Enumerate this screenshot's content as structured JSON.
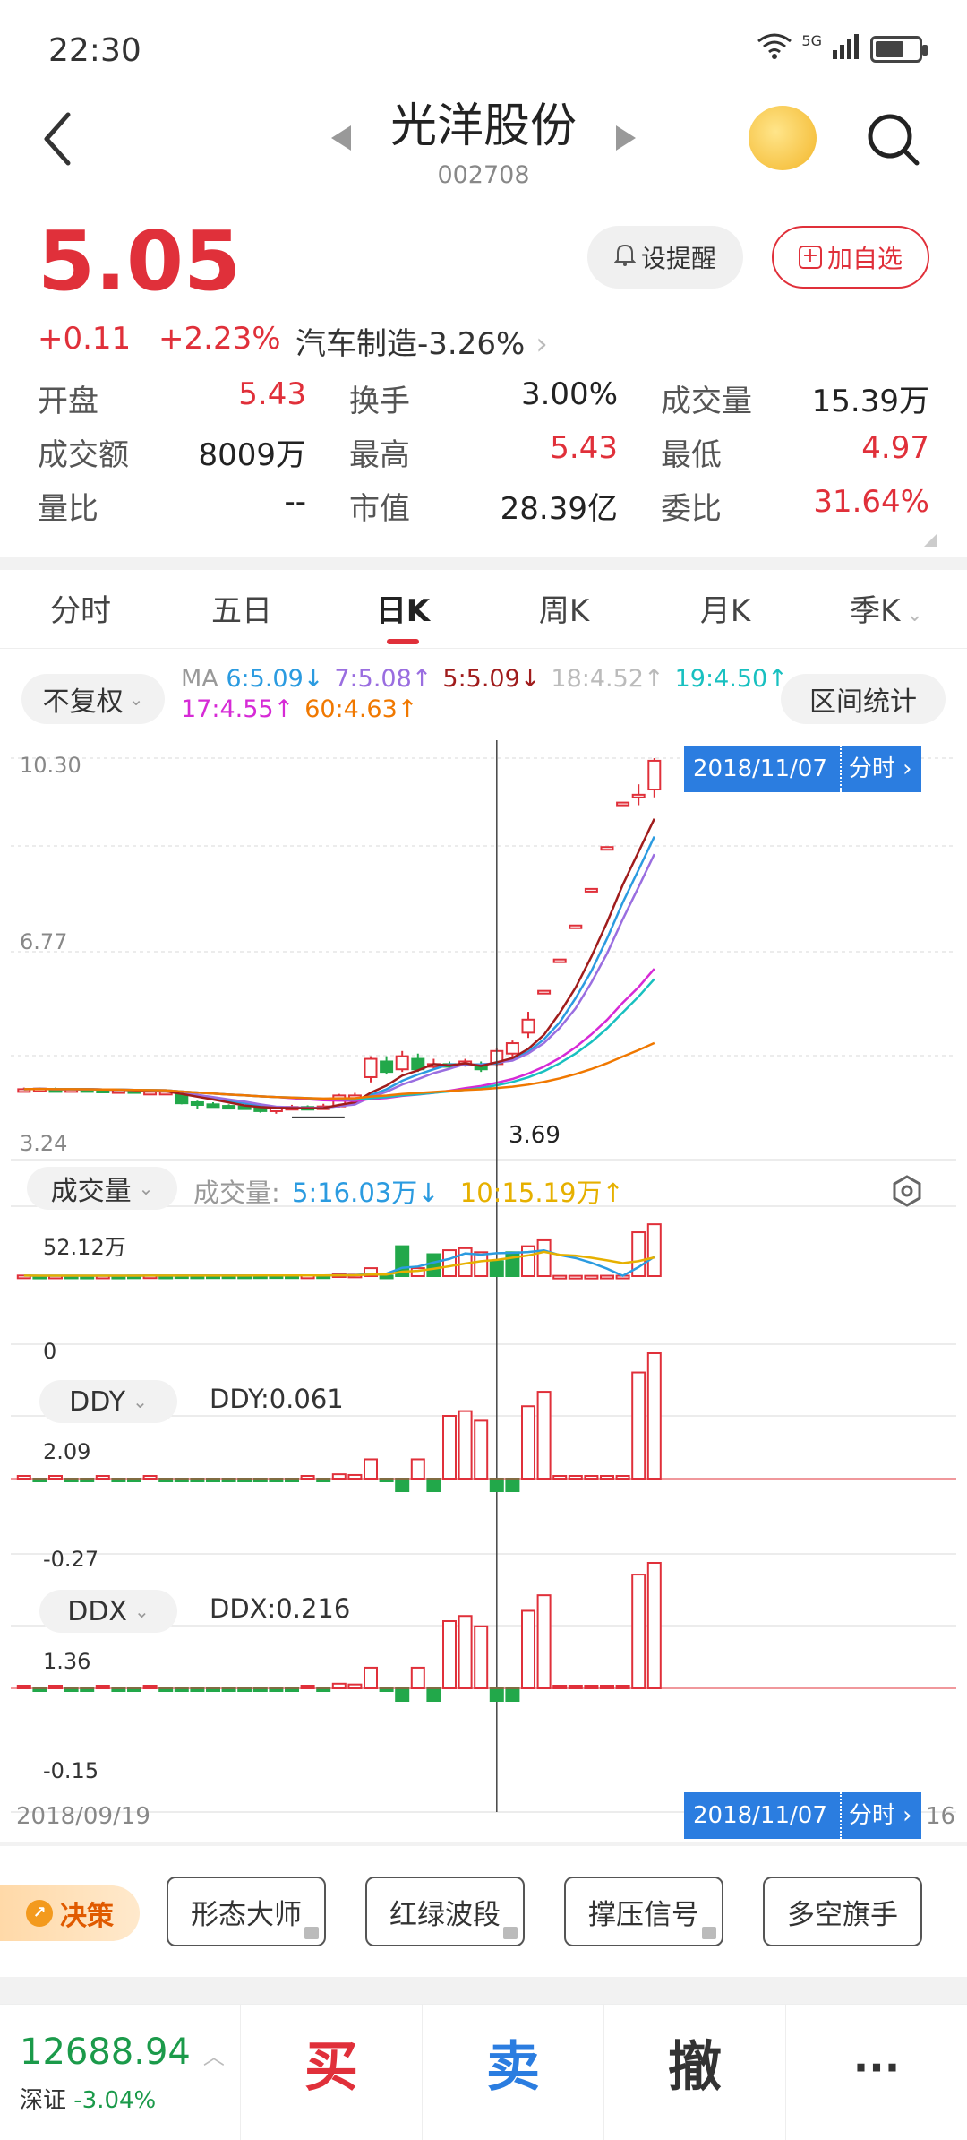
{
  "status": {
    "time": "22:30",
    "network": "5G"
  },
  "header": {
    "stock_name": "光洋股份",
    "stock_code": "002708"
  },
  "quote": {
    "price": "5.05",
    "change": "+0.11",
    "change_pct": "+2.23%",
    "sector": "汽车制造-3.26%",
    "remind_label": "设提醒",
    "fav_label": "加自选"
  },
  "stats": [
    [
      {
        "k": "开盘",
        "v": "5.43",
        "red": true
      },
      {
        "k": "换手",
        "v": "3.00%",
        "red": false
      },
      {
        "k": "成交量",
        "v": "15.39万",
        "red": false
      }
    ],
    [
      {
        "k": "成交额",
        "v": "8009万",
        "red": false
      },
      {
        "k": "最高",
        "v": "5.43",
        "red": true
      },
      {
        "k": "最低",
        "v": "4.97",
        "red": true
      }
    ],
    [
      {
        "k": "量比",
        "v": "--",
        "red": false
      },
      {
        "k": "市值",
        "v": "28.39亿",
        "red": false
      },
      {
        "k": "委比",
        "v": "31.64%",
        "red": true
      }
    ]
  ],
  "tabs": [
    "分时",
    "五日",
    "日K",
    "周K",
    "月K",
    "季K"
  ],
  "active_tab": "日K",
  "ma": {
    "fq_label": "不复权",
    "range_label": "区间统计",
    "prefix": "MA",
    "items1": [
      {
        "text": "6:5.09↓",
        "color": "#2b9be0"
      },
      {
        "text": "7:5.08↑",
        "color": "#9a6ee0"
      },
      {
        "text": "5:5.09↓",
        "color": "#a01c1c"
      },
      {
        "text": "18:4.52↑",
        "color": "#bbbbbb"
      },
      {
        "text": "19:4.50↑",
        "color": "#18c0c0"
      }
    ],
    "items2": [
      {
        "text": "17:4.55↑",
        "color": "#d62ad6"
      },
      {
        "text": "60:4.63↑",
        "color": "#f07800"
      }
    ]
  },
  "kline": {
    "y_top": "10.30",
    "y_mid": "6.77",
    "y_bottom": "3.24",
    "low_marker": "3.69",
    "cursor_date": "2018/11/07",
    "cursor_link": "分时",
    "start_date": "2018/09/19",
    "end_label": "16"
  },
  "volume": {
    "button": "成交量",
    "label": "成交量:",
    "ma5": "5:16.03万↓",
    "ma10": "10:15.19万↑",
    "y_top": "52.12万",
    "y_zero": "0"
  },
  "ddy": {
    "button": "DDY",
    "value_label": "DDY:0.061",
    "y_top": "2.09",
    "y_bottom": "-0.27"
  },
  "ddx": {
    "button": "DDX",
    "value_label": "DDX:0.216",
    "y_top": "1.36",
    "y_bottom": "-0.15"
  },
  "strategy": {
    "decision": "决策",
    "buttons": [
      "形态大师",
      "红绿波段",
      "撑压信号",
      "多空旗手"
    ]
  },
  "trade": {
    "index_value": "12688.94",
    "index_name": "深证",
    "index_change": "-3.04%",
    "buy": "买",
    "sell": "卖",
    "cancel": "撤",
    "more": "···"
  },
  "chart_data": [
    {
      "type": "candlestick",
      "ylim": [
        3.24,
        10.3
      ],
      "candles": [
        {
          "o": 3.95,
          "c": 3.97,
          "h": 4.0,
          "l": 3.92
        },
        {
          "o": 3.96,
          "c": 3.98,
          "h": 4.0,
          "l": 3.93
        },
        {
          "o": 3.97,
          "c": 3.96,
          "h": 4.0,
          "l": 3.93
        },
        {
          "o": 3.96,
          "c": 3.97,
          "h": 3.99,
          "l": 3.93
        },
        {
          "o": 3.97,
          "c": 3.96,
          "h": 3.99,
          "l": 3.93
        },
        {
          "o": 3.96,
          "c": 3.95,
          "h": 3.98,
          "l": 3.92
        },
        {
          "o": 3.95,
          "c": 3.95,
          "h": 3.98,
          "l": 3.92
        },
        {
          "o": 3.95,
          "c": 3.91,
          "h": 3.97,
          "l": 3.9
        },
        {
          "o": 3.91,
          "c": 3.92,
          "h": 3.95,
          "l": 3.89
        },
        {
          "o": 3.92,
          "c": 3.92,
          "h": 3.95,
          "l": 3.89
        },
        {
          "o": 3.92,
          "c": 3.7,
          "h": 3.93,
          "l": 3.68
        },
        {
          "o": 3.72,
          "c": 3.68,
          "h": 3.75,
          "l": 3.6
        },
        {
          "o": 3.68,
          "c": 3.65,
          "h": 3.72,
          "l": 3.62
        },
        {
          "o": 3.65,
          "c": 3.63,
          "h": 3.68,
          "l": 3.6
        },
        {
          "o": 3.64,
          "c": 3.63,
          "h": 3.67,
          "l": 3.6
        },
        {
          "o": 3.63,
          "c": 3.55,
          "h": 3.66,
          "l": 3.52
        },
        {
          "o": 3.55,
          "c": 3.6,
          "h": 3.64,
          "l": 3.5
        },
        {
          "o": 3.6,
          "c": 3.63,
          "h": 3.67,
          "l": 3.58
        },
        {
          "o": 3.63,
          "c": 3.62,
          "h": 3.66,
          "l": 3.58
        },
        {
          "o": 3.62,
          "c": 3.64,
          "h": 3.69,
          "l": 3.6
        },
        {
          "o": 3.64,
          "c": 3.85,
          "h": 3.88,
          "l": 3.62
        },
        {
          "o": 3.85,
          "c": 3.85,
          "h": 3.9,
          "l": 3.8
        },
        {
          "o": 4.2,
          "c": 4.55,
          "h": 4.6,
          "l": 4.1
        },
        {
          "o": 4.5,
          "c": 4.3,
          "h": 4.6,
          "l": 4.25
        },
        {
          "o": 4.35,
          "c": 4.6,
          "h": 4.7,
          "l": 4.3
        },
        {
          "o": 4.55,
          "c": 4.35,
          "h": 4.65,
          "l": 4.3
        },
        {
          "o": 4.4,
          "c": 4.45,
          "h": 4.55,
          "l": 4.35
        },
        {
          "o": 4.45,
          "c": 4.42,
          "h": 4.5,
          "l": 4.38
        },
        {
          "o": 4.45,
          "c": 4.5,
          "h": 4.55,
          "l": 4.4
        },
        {
          "o": 4.42,
          "c": 4.35,
          "h": 4.5,
          "l": 4.3
        },
        {
          "o": 4.45,
          "c": 4.7,
          "h": 4.75,
          "l": 4.4
        },
        {
          "o": 4.65,
          "c": 4.85,
          "h": 4.9,
          "l": 4.5
        },
        {
          "o": 5.05,
          "c": 5.3,
          "h": 5.45,
          "l": 4.95
        },
        {
          "o": 5.85,
          "c": 5.85,
          "h": 5.85,
          "l": 5.85
        },
        {
          "o": 6.45,
          "c": 6.45,
          "h": 6.45,
          "l": 6.45
        },
        {
          "o": 7.1,
          "c": 7.1,
          "h": 7.1,
          "l": 7.1
        },
        {
          "o": 7.8,
          "c": 7.8,
          "h": 7.8,
          "l": 7.8
        },
        {
          "o": 8.6,
          "c": 8.6,
          "h": 8.6,
          "l": 8.6
        },
        {
          "o": 9.45,
          "c": 9.45,
          "h": 9.45,
          "l": 9.45
        },
        {
          "o": 9.55,
          "c": 9.6,
          "h": 9.8,
          "l": 9.4
        },
        {
          "o": 9.7,
          "c": 10.25,
          "h": 10.3,
          "l": 9.55
        }
      ],
      "series": [
        {
          "name": "6",
          "color": "#2b9be0"
        },
        {
          "name": "7",
          "color": "#9a6ee0"
        },
        {
          "name": "5",
          "color": "#a01c1c"
        },
        {
          "name": "17",
          "color": "#d62ad6"
        },
        {
          "name": "19",
          "color": "#18c0c0"
        },
        {
          "name": "60",
          "color": "#f07800"
        }
      ]
    },
    {
      "type": "bar",
      "ylim": [
        0,
        52.12
      ],
      "values": [
        0.6,
        0.4,
        0.5,
        0.5,
        0.4,
        0.5,
        0.4,
        0.6,
        0.7,
        0.5,
        0.8,
        0.6,
        0.7,
        0.7,
        0.6,
        0.7,
        0.8,
        0.7,
        0.6,
        0.7,
        1.8,
        1.5,
        8,
        0.5,
        30,
        8,
        22,
        26,
        28,
        24,
        15,
        24,
        30,
        36,
        0.3,
        0.3,
        0.3,
        0.4,
        0.4,
        44,
        52
      ],
      "up": [
        1,
        0,
        1,
        0,
        0,
        1,
        0,
        0,
        1,
        0,
        0,
        0,
        0,
        0,
        0,
        0,
        0,
        0,
        1,
        0,
        1,
        1,
        1,
        0,
        0,
        1,
        0,
        1,
        1,
        1,
        0,
        0,
        1,
        1,
        1,
        1,
        1,
        1,
        1,
        1,
        1
      ]
    }
  ]
}
